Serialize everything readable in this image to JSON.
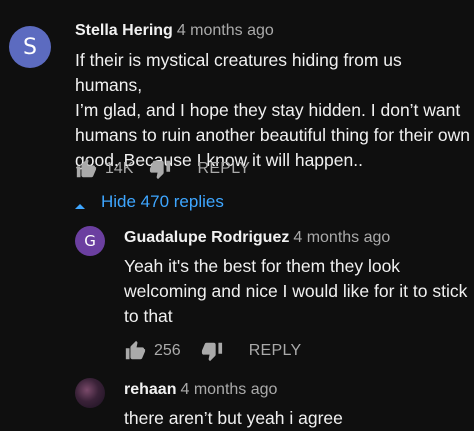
{
  "comments": [
    {
      "author": "Stella Hering",
      "avatar_letter": "S",
      "avatar_color": "#5c6bc0",
      "time": "4 months ago",
      "text_lines": [
        "If their is mystical creatures hiding from us humans,",
        "I’m glad, and I hope they stay hidden. I don’t want",
        "humans to ruin another beautiful thing for their own",
        "good. Because I know it will happen.."
      ],
      "likes": "14K",
      "reply_label": "REPLY"
    }
  ],
  "replies_toggle": {
    "label": "Hide 470 replies",
    "icon": "caret-up-icon"
  },
  "replies": [
    {
      "author": "Guadalupe Rodriguez",
      "avatar_letter": "G",
      "avatar_color": "#6b3fa0",
      "time": "4 months ago",
      "text_lines": [
        "Yeah it's the best for them they look",
        "welcoming and nice I would like for it to stick",
        "to that"
      ],
      "likes": "256",
      "reply_label": "REPLY"
    },
    {
      "author": "rehaan",
      "avatar_letter": "",
      "avatar_color": "#2a1a2e",
      "time": "4 months ago",
      "text_lines": [
        "there aren’t but yeah i agree"
      ]
    }
  ],
  "colors": {
    "background": "#0f0f0f",
    "link": "#3ea6ff",
    "secondary_text": "#aaaaaa"
  },
  "icons": [
    "thumbs-up-icon",
    "thumbs-down-icon",
    "caret-up-icon"
  ]
}
